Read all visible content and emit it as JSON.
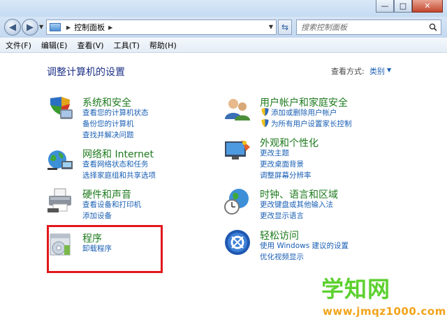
{
  "window": {
    "minimize": "—",
    "maximize": "□",
    "close": "✕"
  },
  "address": {
    "breadcrumb": "控制面板",
    "search_placeholder": "搜索控制面板"
  },
  "menu": [
    "文件(F)",
    "编辑(E)",
    "查看(V)",
    "工具(T)",
    "帮助(H)"
  ],
  "header": {
    "title": "调整计算机的设置",
    "view_by_label": "查看方式:",
    "view_by_value": "类别"
  },
  "categories_left": [
    {
      "title": "系统和安全",
      "links": [
        "查看您的计算机状态",
        "备份您的计算机",
        "查找并解决问题"
      ]
    },
    {
      "title": "网络和 Internet",
      "links": [
        "查看网络状态和任务",
        "选择家庭组和共享选项"
      ]
    },
    {
      "title": "硬件和声音",
      "links": [
        "查看设备和打印机",
        "添加设备"
      ]
    },
    {
      "title": "程序",
      "links": [
        "卸载程序"
      ]
    }
  ],
  "categories_right": [
    {
      "title": "用户帐户和家庭安全",
      "links": [
        "添加或删除用户帐户",
        "为所有用户设置家长控制"
      ]
    },
    {
      "title": "外观和个性化",
      "links": [
        "更改主题",
        "更改桌面背景",
        "调整屏幕分辨率"
      ]
    },
    {
      "title": "时钟、语言和区域",
      "links": [
        "更改键盘或其他输入法",
        "更改显示语言"
      ]
    },
    {
      "title": "轻松访问",
      "links": [
        "使用 Windows 建议的设置",
        "优化视频显示"
      ]
    }
  ],
  "watermark": {
    "main": "学知网",
    "url": "www.jmqz1000.com"
  },
  "colors": {
    "category_title": "#1e7a1e",
    "link": "#1a5fb4",
    "highlight": "#e1171c"
  }
}
